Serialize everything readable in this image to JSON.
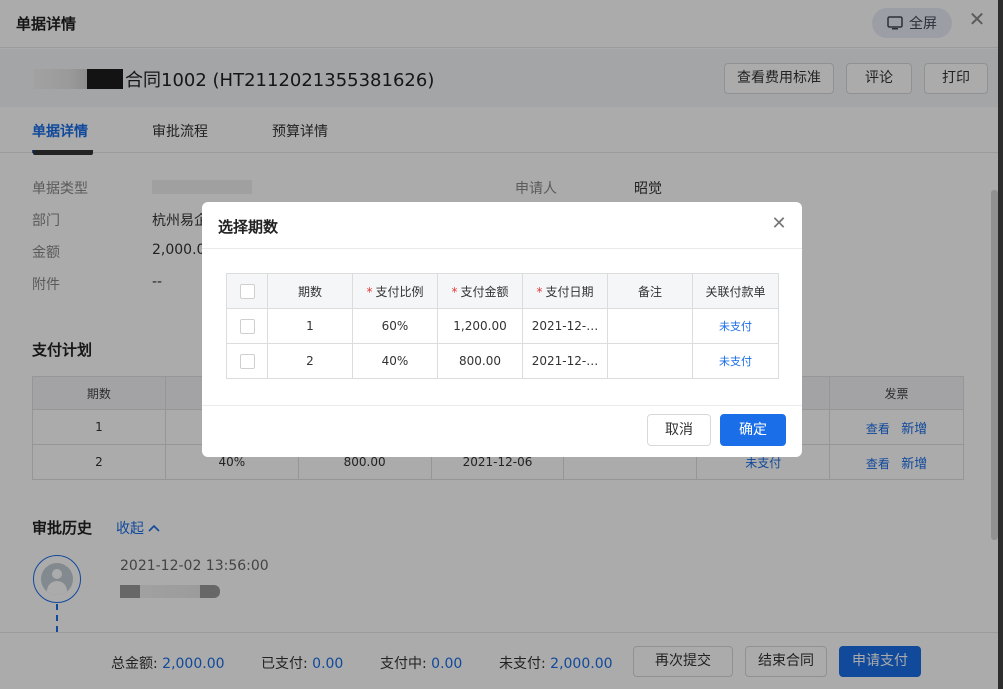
{
  "header": {
    "title": "单据详情",
    "fullscreen_label": "全屏"
  },
  "titlebar": {
    "doc_title": "合同1002 (HT2112021355381626)",
    "buttons": [
      "查看费用标准",
      "评论",
      "打印"
    ]
  },
  "tabs": [
    "单据详情",
    "审批流程",
    "预算详情"
  ],
  "info": {
    "doc_type_label": "单据类型",
    "dept_label": "部门",
    "dept_value": "杭州易企",
    "amount_label": "金额",
    "amount_value": "2,000.0",
    "attachment_label": "附件",
    "attachment_value": "--",
    "applicant_label": "申请人",
    "applicant_value": "昭觉"
  },
  "payment_plan": {
    "title": "支付计划",
    "headers": [
      "期数",
      "",
      "",
      "",
      "",
      "",
      "发票"
    ],
    "rows": [
      {
        "period": "1",
        "ratio": "",
        "amount": "",
        "date": "",
        "note": "",
        "status": "",
        "view": "查看",
        "add": "新增"
      },
      {
        "period": "2",
        "ratio": "40%",
        "amount": "800.00",
        "date": "2021-12-06",
        "note": "",
        "status": "未支付",
        "view": "查看",
        "add": "新增"
      }
    ]
  },
  "history": {
    "title": "审批历史",
    "collapse_label": "收起",
    "timestamp": "2021-12-02 13:56:00"
  },
  "footer": {
    "total_label": "总金额:",
    "total_value": "2,000.00",
    "paid_label": "已支付:",
    "paid_value": "0.00",
    "paying_label": "支付中:",
    "paying_value": "0.00",
    "unpaid_label": "未支付:",
    "unpaid_value": "2,000.00",
    "resubmit": "再次提交",
    "end_contract": "结束合同",
    "apply_pay": "申请支付"
  },
  "modal": {
    "title": "选择期数",
    "headers": [
      "期数",
      "支付比例",
      "支付金额",
      "支付日期",
      "备注",
      "关联付款单"
    ],
    "rows": [
      {
        "period": "1",
        "ratio": "60%",
        "amount": "1,200.00",
        "date": "2021-12-…",
        "note": "",
        "link": "未支付"
      },
      {
        "period": "2",
        "ratio": "40%",
        "amount": "800.00",
        "date": "2021-12-…",
        "note": "",
        "link": "未支付"
      }
    ],
    "cancel": "取消",
    "confirm": "确定"
  },
  "colors": {
    "primary": "#1a6ee8",
    "required": "#e53935"
  },
  "icons": [
    "fullscreen-icon",
    "close-icon",
    "chevron-up-icon",
    "avatar-icon",
    "checkbox-icon"
  ]
}
